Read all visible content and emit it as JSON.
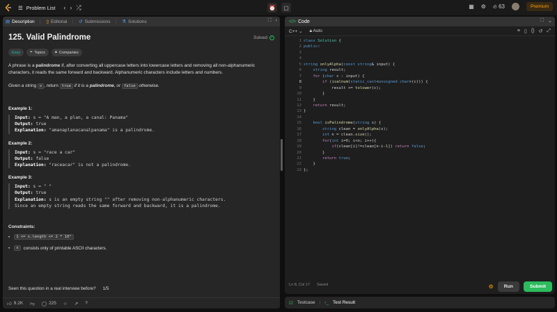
{
  "topbar": {
    "problem_list": "Problem List",
    "streak": "63",
    "premium": "Premium"
  },
  "left": {
    "tabs": [
      "Description",
      "Editorial",
      "Submissions",
      "Solutions"
    ],
    "title": "125. Valid Palindrome",
    "solved": "Solved",
    "pills": [
      "Easy",
      "Topics",
      "Companies"
    ],
    "desc": {
      "p1_a": "A phrase is a ",
      "p1_b": "palindrome",
      "p1_c": " if, after converting all uppercase letters into lowercase letters and removing all non-alphanumeric characters, it reads the same forward and backward. Alphanumeric characters include letters and numbers.",
      "p2_a": "Given a string ",
      "p2_s": "s",
      "p2_b": ", return ",
      "p2_true": "true",
      "p2_c": " if it is a ",
      "p2_d": "palindrome",
      "p2_e": ", or ",
      "p2_false": "false",
      "p2_f": " otherwise."
    },
    "examples": [
      {
        "title": "Example 1:",
        "input": "s = \"A man, a plan, a canal: Panama\"",
        "output": "true",
        "explanation": "\"amanaplanacanalpanama\" is a palindrome."
      },
      {
        "title": "Example 2:",
        "input": "s = \"race a car\"",
        "output": "false",
        "explanation": "\"raceacar\" is not a palindrome."
      },
      {
        "title": "Example 3:",
        "input": "s = \" \"",
        "output": "true",
        "explanation": "s is an empty string \"\" after removing non-alphanumeric characters.",
        "explanation2": "Since an empty string reads the same forward and backward, it is a palindrome."
      }
    ],
    "labels": {
      "input": "Input:",
      "output": "Output:",
      "explanation": "Explanation:"
    },
    "constraints_title": "Constraints:",
    "constraint1": "1 <= s.length <= 2 * 10⁵",
    "constraint2_code": "s",
    "constraint2_text": "consists only of printable ASCII characters.",
    "seen": "Seen this question in a real interview before?",
    "seen_count": "1/5",
    "likes": "9.2K",
    "comments": "225"
  },
  "code": {
    "title": "Code",
    "lang": "C++",
    "mode": "Auto",
    "lines": [
      "class Solution {",
      "public:",
      "",
      "",
      "string onlyAlpha(const string& input) {",
      "    string result;",
      "    for (char c : input) {",
      "        if (isalnum(static_cast<unsigned char>(c))) {",
      "            result += tolower(c);",
      "        }",
      "    }",
      "    return result;",
      "}",
      "",
      "    bool isPalindrome(string s) {",
      "        string clean = onlyAlpha(s);",
      "        int n = clean.size();",
      "        for(int i=0; i<n; i++){",
      "            if(clean[i]!=clean[n-i-1]) return false;",
      "        }",
      "        return true;",
      "    }",
      "};"
    ],
    "status_pos": "Ln 8, Col 17",
    "status_saved": "Saved",
    "run": "Run",
    "submit": "Submit"
  },
  "bottom": {
    "testcase": "Testcase",
    "result": "Test Result"
  }
}
